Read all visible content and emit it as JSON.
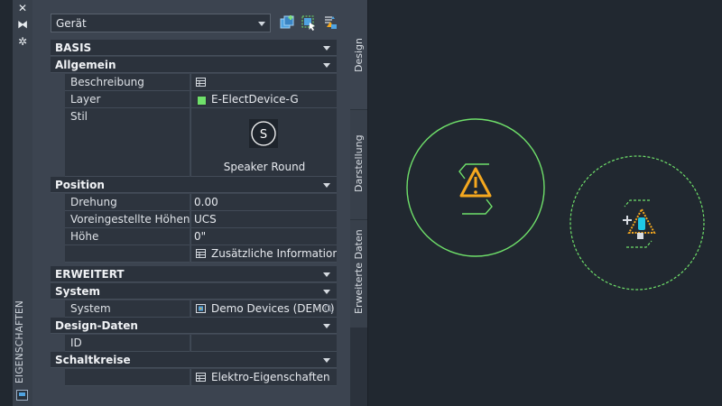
{
  "left_strip": {
    "close": "✕",
    "autohide": "⧓",
    "settings": "✲",
    "title": "EIGENSCHAFTEN"
  },
  "combo": {
    "value": "Gerät"
  },
  "sections": {
    "basis": "BASIS",
    "allgemein": "Allgemein",
    "position": "Position",
    "erweitert": "ERWEITERT",
    "system": "System",
    "design_daten": "Design-Daten",
    "schaltkreise": "Schaltkreise"
  },
  "rows": {
    "beschreibung": {
      "label": "Beschreibung",
      "value": ""
    },
    "layer": {
      "label": "Layer",
      "value": "E-ElectDevice-G",
      "color": "#6fe06a"
    },
    "stil": {
      "label": "Stil",
      "value": "Speaker Round",
      "glyph": "S"
    },
    "drehung": {
      "label": "Drehung",
      "value": "0.00"
    },
    "voreingestellt": {
      "label": "Voreingestellte  Höhen…",
      "value": "UCS"
    },
    "hoehe": {
      "label": "Höhe",
      "value": "0\""
    },
    "zusaetzlich": {
      "label": "",
      "value": "Zusätzliche  Information…"
    },
    "system": {
      "label": "System",
      "value": "Demo Devices (DEMO)"
    },
    "id": {
      "label": "ID",
      "value": ""
    },
    "elektro": {
      "label": "",
      "value": "Elektro-Eigenschaften"
    }
  },
  "tabs": [
    "Design",
    "Darstellung",
    "Erweiterte Daten"
  ],
  "colors": {
    "accent_green": "#6fe06a",
    "warning": "#f5a81f",
    "canvas": "#212830"
  }
}
